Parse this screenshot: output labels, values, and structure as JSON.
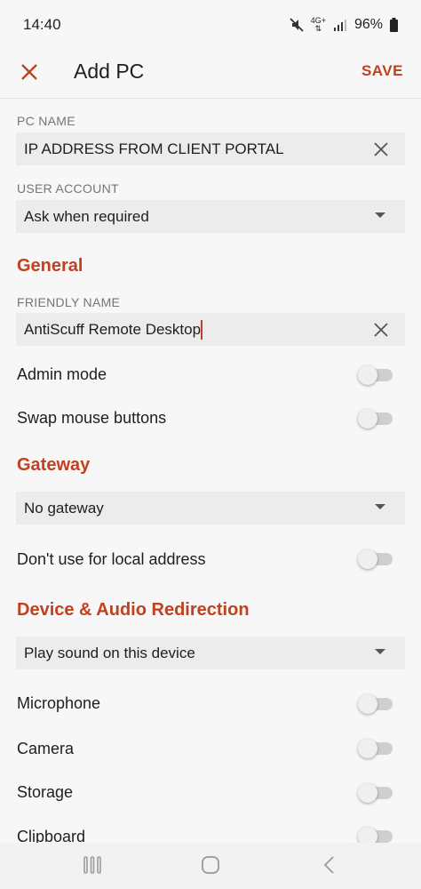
{
  "status_bar": {
    "time": "14:40",
    "network": "4G+",
    "battery": "96%",
    "icons": [
      "mute-icon",
      "network-4g-icon",
      "signal-icon",
      "battery-icon"
    ]
  },
  "app_bar": {
    "title": "Add PC",
    "save_label": "SAVE",
    "close_icon": "close-icon"
  },
  "pc_name": {
    "label": "PC NAME",
    "value": "IP ADDRESS FROM CLIENT PORTAL"
  },
  "user_account": {
    "label": "USER ACCOUNT",
    "selected": "Ask when required"
  },
  "general": {
    "title": "General",
    "friendly_name_label": "FRIENDLY NAME",
    "friendly_name_value": "AntiScuff Remote Desktop",
    "admin_mode_label": "Admin mode",
    "admin_mode_on": false,
    "swap_mouse_label": "Swap mouse buttons",
    "swap_mouse_on": false
  },
  "gateway": {
    "title": "Gateway",
    "selected": "No gateway",
    "local_address_label": "Don't use for local address",
    "local_address_on": false
  },
  "redirection": {
    "title": "Device & Audio Redirection",
    "sound_selected": "Play sound on this device",
    "microphone_label": "Microphone",
    "camera_label": "Camera",
    "storage_label": "Storage",
    "clipboard_label": "Clipboard"
  },
  "colors": {
    "accent": "#c0411f",
    "background": "#f7f7f7",
    "field": "#ececec"
  },
  "nav_bar": {
    "icons": [
      "recents-icon",
      "home-icon",
      "back-icon"
    ]
  }
}
